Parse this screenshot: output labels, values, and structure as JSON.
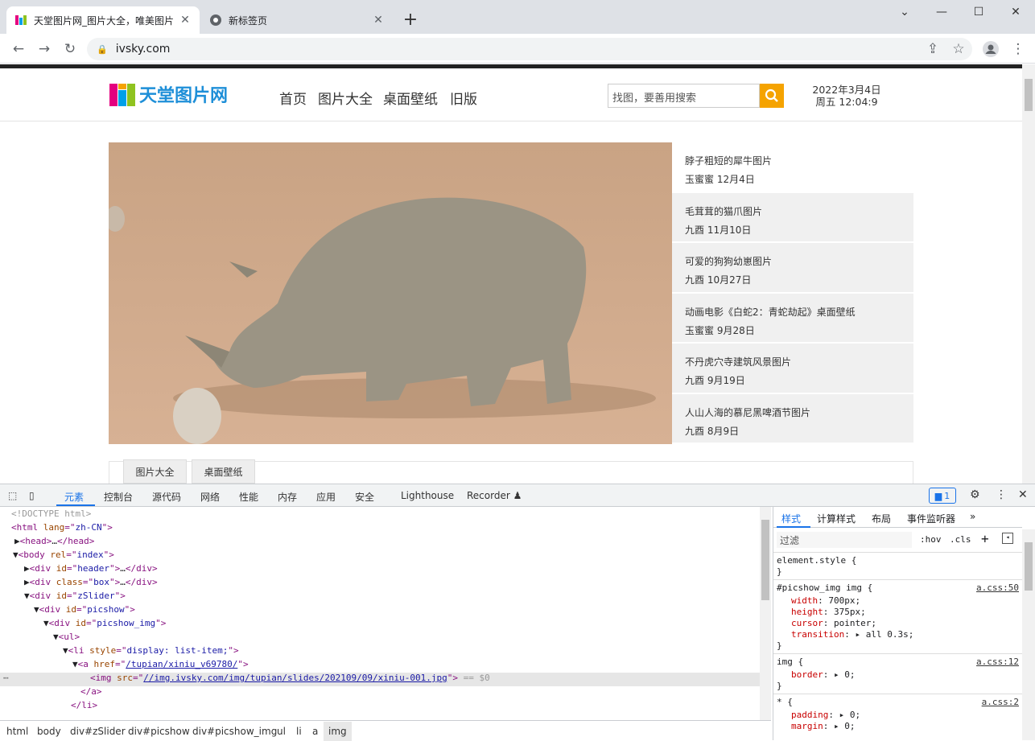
{
  "browser": {
    "tabs": [
      {
        "title": "天堂图片网_图片大全，唯美图片"
      },
      {
        "title": "新标签页"
      }
    ],
    "url": "ivsky.com"
  },
  "site": {
    "logo_text": "天堂图片网",
    "nav": [
      "首页",
      "图片大全",
      "桌面壁纸",
      "旧版"
    ],
    "search_placeholder": "找图，要善用搜索",
    "date": "2022年3月4日",
    "time": "周五 12:04:9",
    "slides": [
      {
        "title": "脖子粗短的犀牛图片",
        "meta": "玉蜜蜜 12月4日"
      },
      {
        "title": "毛茸茸的猫爪图片",
        "meta": "九酉 11月10日"
      },
      {
        "title": "可爱的狗狗幼崽图片",
        "meta": "九酉 10月27日"
      },
      {
        "title": "动画电影《白蛇2：青蛇劫起》桌面壁纸",
        "meta": "玉蜜蜜 9月28日"
      },
      {
        "title": "不丹虎穴寺建筑风景图片",
        "meta": "九酉 9月19日"
      },
      {
        "title": "人山人海的慕尼黑啤酒节图片",
        "meta": "九酉 8月9日"
      }
    ],
    "section_tabs": [
      "图片大全",
      "桌面壁纸"
    ]
  },
  "devtools": {
    "tabs": [
      "元素",
      "控制台",
      "源代码",
      "网络",
      "性能",
      "内存",
      "应用",
      "安全",
      "Lighthouse",
      "Recorder ♟"
    ],
    "issues": "1",
    "breadcrumbs": [
      "html",
      "body",
      "div#zSlider",
      "div#picshow",
      "div#picshow_img",
      "ul",
      "li",
      "a",
      "img"
    ],
    "styles_tabs": [
      "样式",
      "计算样式",
      "布局",
      "事件监听器"
    ],
    "filter_placeholder": "过滤",
    "hov": ":hov",
    "cls": ".cls"
  },
  "dom": {
    "doctype": "<!DOCTYPE html>",
    "img_src": "//img.ivsky.com/img/tupian/slides/202109/09/xiniu-001.jpg",
    "a_href": "/tupian/xiniu_v69780/",
    "eq": "== $0"
  }
}
